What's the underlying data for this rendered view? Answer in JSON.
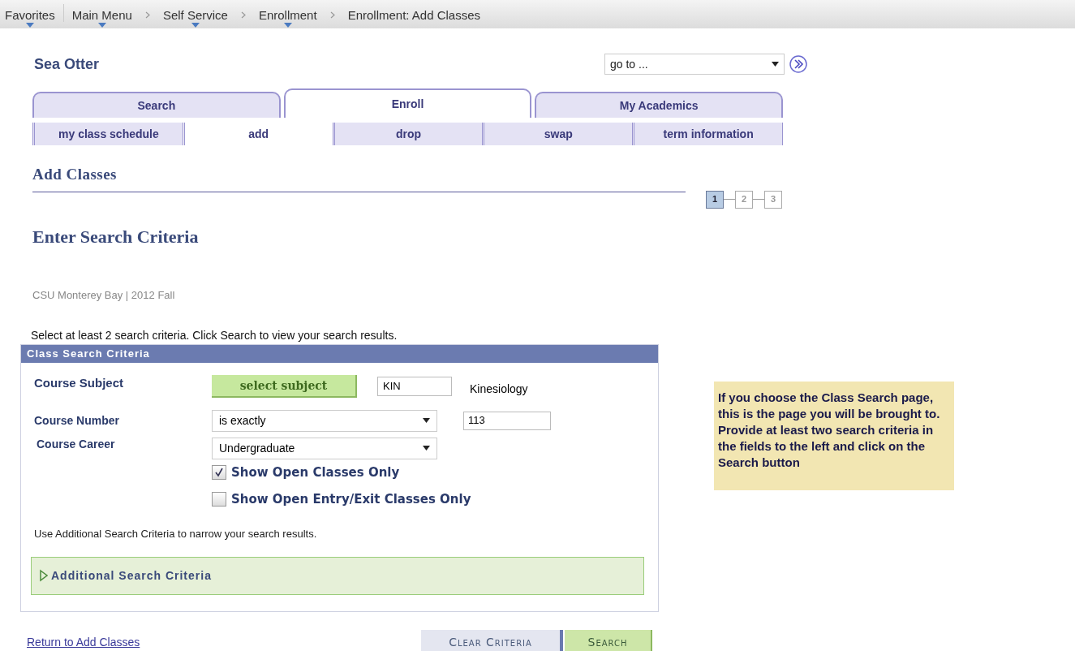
{
  "breadcrumbs": [
    {
      "label": "Favorites",
      "has_menu": true
    },
    {
      "label": "Main Menu",
      "has_menu": true
    },
    {
      "label": "Self Service",
      "has_menu": true
    },
    {
      "label": "Enrollment",
      "has_menu": true
    },
    {
      "label": "Enrollment: Add Classes",
      "has_menu": false
    }
  ],
  "header": {
    "title": "Sea Otter",
    "goto": {
      "value": "go to ..."
    }
  },
  "tabs": [
    {
      "label": "Search",
      "selected": false
    },
    {
      "label": "Enroll",
      "selected": true
    },
    {
      "label": "My Academics",
      "selected": false
    }
  ],
  "subtabs": [
    {
      "label": "my class schedule",
      "selected": false
    },
    {
      "label": "add",
      "selected": true
    },
    {
      "label": "drop",
      "selected": false
    },
    {
      "label": "swap",
      "selected": false
    },
    {
      "label": "term information",
      "selected": false
    }
  ],
  "page_title": "Add Classes",
  "steps": [
    {
      "label": "1",
      "selected": true
    },
    {
      "label": "2",
      "selected": false
    },
    {
      "label": "3",
      "selected": false
    }
  ],
  "section_title": "Enter Search Criteria",
  "term": "CSU Monterey Bay | 2012 Fall",
  "instruction": "Select at least 2 search criteria. Click Search to view your search results.",
  "panel": {
    "title": "Class Search Criteria",
    "subject": {
      "label": "Course Subject",
      "button": "select subject",
      "value": "KIN",
      "description": "Kinesiology"
    },
    "number": {
      "label": "Course Number",
      "operator": "is exactly",
      "value": "113"
    },
    "career": {
      "label": "Course Career",
      "value": "Undergraduate"
    },
    "options": [
      {
        "label": "Show Open Classes Only",
        "checked": true
      },
      {
        "label": "Show Open Entry/Exit Classes Only",
        "checked": false
      }
    ],
    "hint": "Use Additional Search Criteria to narrow your search results.",
    "additional": {
      "label": "Additional Search Criteria",
      "expanded": false
    }
  },
  "link": "Return to Add Classes",
  "buttons": [
    {
      "label": "Clear Criteria",
      "kind": "secondary"
    },
    {
      "label": "Search",
      "kind": "primary"
    }
  ],
  "note": "If you choose the Class Search page, this is the page you will be brought to.  Provide at least two search criteria in the fields to the left and click on the Search button"
}
